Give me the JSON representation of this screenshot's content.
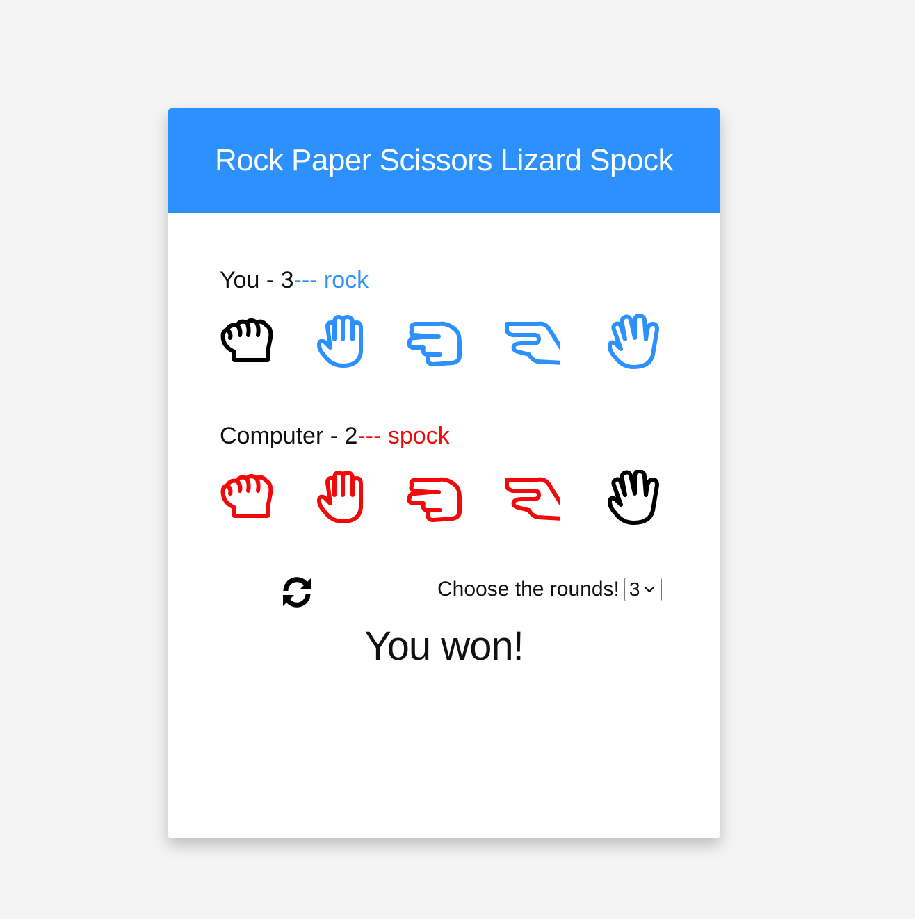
{
  "header": {
    "title": "Rock Paper Scissors Lizard Spock"
  },
  "you": {
    "label": "You - 3",
    "separator": "---",
    "choice": "rock",
    "color": "#2d91fd"
  },
  "computer": {
    "label": "Computer - 2",
    "separator": "---",
    "choice": "spock",
    "color": "#f00a0a"
  },
  "selected_color": "#000000",
  "hands": [
    "rock-icon",
    "paper-icon",
    "scissors-icon",
    "lizard-icon",
    "spock-icon"
  ],
  "controls": {
    "refresh_icon": "refresh-icon",
    "rounds_label": "Choose the rounds!",
    "rounds_value": "3"
  },
  "result": "You won!"
}
